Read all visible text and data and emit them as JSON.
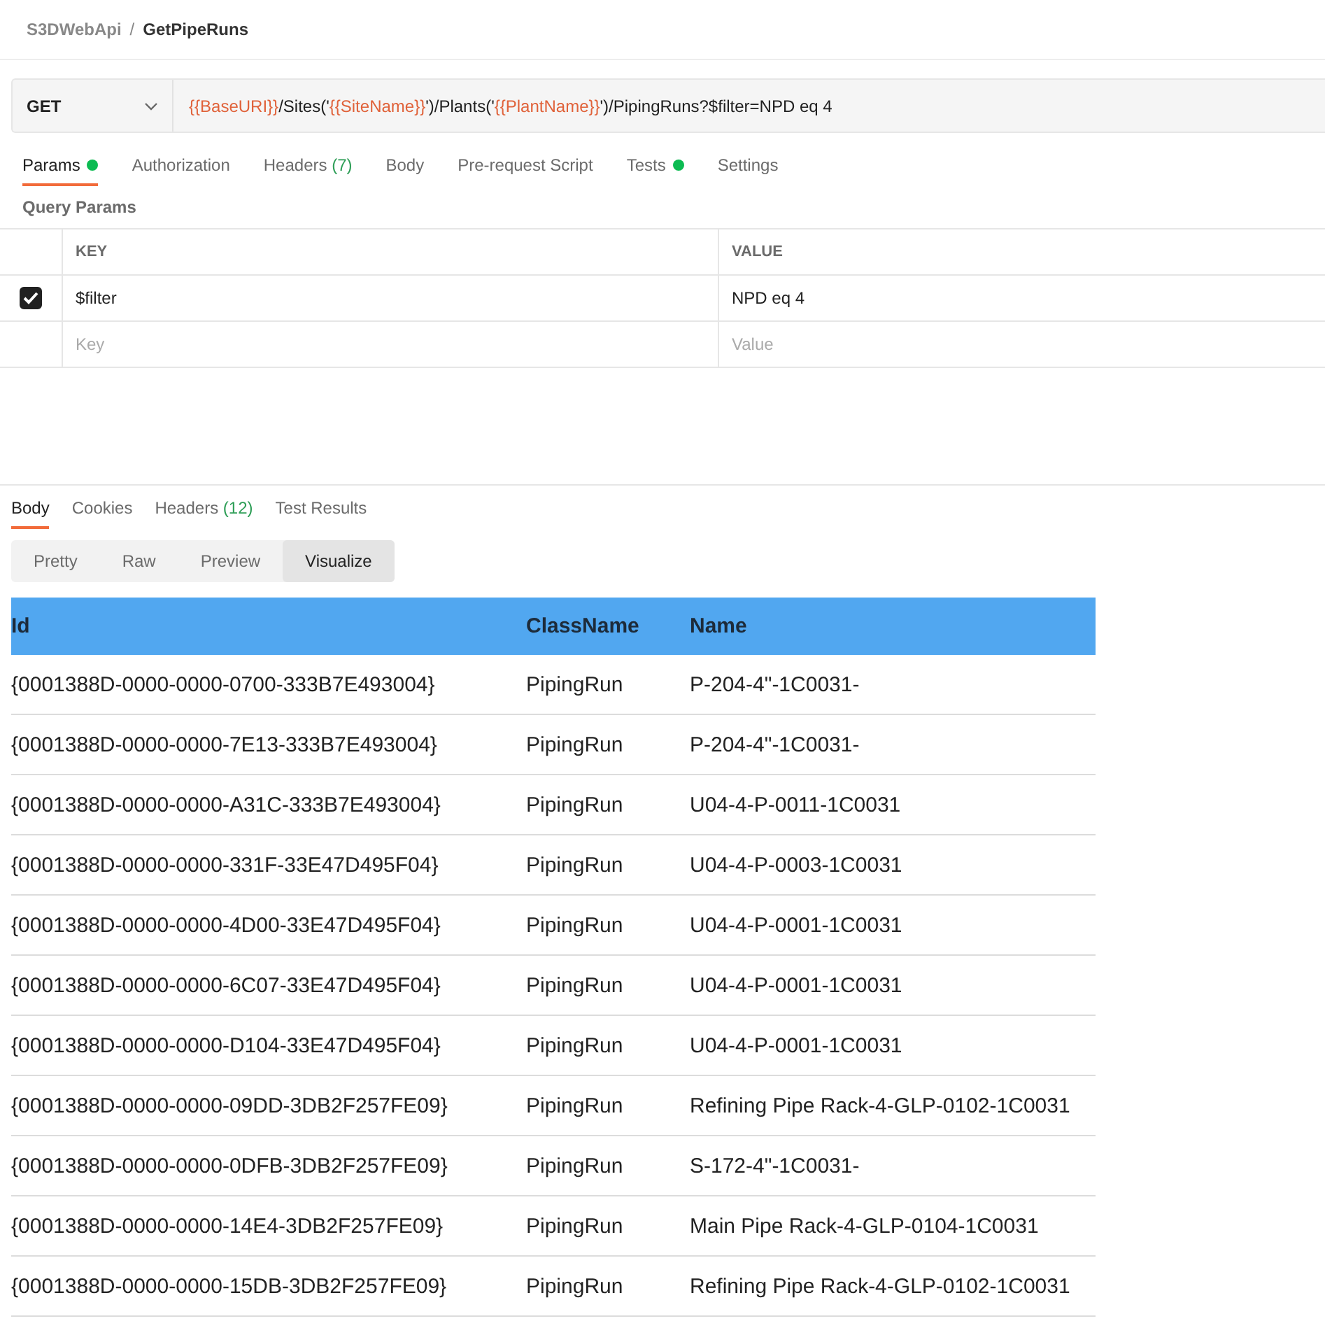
{
  "breadcrumb": {
    "collection": "S3DWebApi",
    "separator": "/",
    "request": "GetPipeRuns"
  },
  "request": {
    "method": "GET",
    "url": [
      {
        "kind": "var",
        "text": "{{BaseURI}}"
      },
      {
        "kind": "text",
        "text": "/Sites('"
      },
      {
        "kind": "var",
        "text": "{{SiteName}}"
      },
      {
        "kind": "text",
        "text": "')/Plants('"
      },
      {
        "kind": "var",
        "text": "{{PlantName}}"
      },
      {
        "kind": "text",
        "text": "')/PipingRuns?$filter=NPD eq 4"
      }
    ]
  },
  "request_tabs": [
    {
      "label": "Params",
      "dot": true,
      "selected": true
    },
    {
      "label": "Authorization",
      "dot": false,
      "selected": false
    },
    {
      "label": "Headers",
      "count": "(7)",
      "dot": false,
      "selected": false
    },
    {
      "label": "Body",
      "dot": false,
      "selected": false
    },
    {
      "label": "Pre-request Script",
      "dot": false,
      "selected": false
    },
    {
      "label": "Tests",
      "dot": true,
      "selected": false
    },
    {
      "label": "Settings",
      "dot": false,
      "selected": false
    }
  ],
  "query_params": {
    "title": "Query Params",
    "columns": [
      "KEY",
      "VALUE"
    ],
    "rows": [
      {
        "checked": true,
        "key": "$filter",
        "value": "NPD eq 4"
      }
    ],
    "new_row": {
      "key_placeholder": "Key",
      "value_placeholder": "Value"
    }
  },
  "response_tabs": [
    {
      "label": "Body",
      "selected": true
    },
    {
      "label": "Cookies",
      "selected": false
    },
    {
      "label": "Headers",
      "count": "(12)",
      "selected": false
    },
    {
      "label": "Test Results",
      "selected": false
    }
  ],
  "view_modes": [
    {
      "label": "Pretty",
      "selected": false
    },
    {
      "label": "Raw",
      "selected": false
    },
    {
      "label": "Preview",
      "selected": false
    },
    {
      "label": "Visualize",
      "selected": true
    }
  ],
  "result_table": {
    "columns": [
      "Id",
      "ClassName",
      "Name"
    ],
    "rows": [
      [
        "{0001388D-0000-0000-0700-333B7E493004}",
        "PipingRun",
        "P-204-4\"-1C0031-"
      ],
      [
        "{0001388D-0000-0000-7E13-333B7E493004}",
        "PipingRun",
        "P-204-4\"-1C0031-"
      ],
      [
        "{0001388D-0000-0000-A31C-333B7E493004}",
        "PipingRun",
        "U04-4-P-0011-1C0031"
      ],
      [
        "{0001388D-0000-0000-331F-33E47D495F04}",
        "PipingRun",
        "U04-4-P-0003-1C0031"
      ],
      [
        "{0001388D-0000-0000-4D00-33E47D495F04}",
        "PipingRun",
        "U04-4-P-0001-1C0031"
      ],
      [
        "{0001388D-0000-0000-6C07-33E47D495F04}",
        "PipingRun",
        "U04-4-P-0001-1C0031"
      ],
      [
        "{0001388D-0000-0000-D104-33E47D495F04}",
        "PipingRun",
        "U04-4-P-0001-1C0031"
      ],
      [
        "{0001388D-0000-0000-09DD-3DB2F257FE09}",
        "PipingRun",
        "Refining Pipe Rack-4-GLP-0102-1C0031"
      ],
      [
        "{0001388D-0000-0000-0DFB-3DB2F257FE09}",
        "PipingRun",
        "S-172-4\"-1C0031-"
      ],
      [
        "{0001388D-0000-0000-14E4-3DB2F257FE09}",
        "PipingRun",
        "Main Pipe Rack-4-GLP-0104-1C0031"
      ],
      [
        "{0001388D-0000-0000-15DB-3DB2F257FE09}",
        "PipingRun",
        "Refining Pipe Rack-4-GLP-0102-1C0031"
      ]
    ]
  }
}
